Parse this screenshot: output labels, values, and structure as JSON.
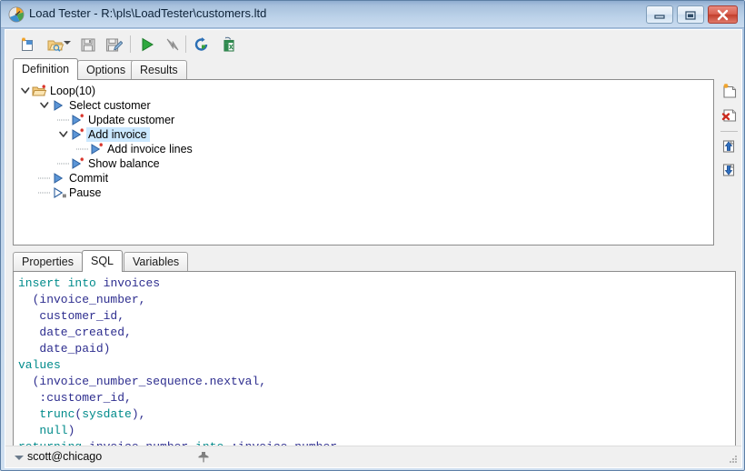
{
  "window": {
    "title": "Load Tester - R:\\pls\\LoadTester\\customers.ltd",
    "icon": "gauge-icon",
    "controls": {
      "minimize": "Minimize",
      "maximize": "Maximize",
      "close": "Close"
    },
    "colors": {
      "titlebar_top": "#8fadd0",
      "titlebar_bottom": "#c9dbef",
      "client_background": "#f0f0f0",
      "selection": "#cbe8ff",
      "close_button": "#c23f2c",
      "sql_keyword": "#008b8b",
      "sql_identifier": "#2e2e8f"
    }
  },
  "toolbar": {
    "buttons": [
      {
        "name": "new-file-button",
        "icon": "new-document-icon",
        "label": "New",
        "enabled": true,
        "has_dropdown": false
      },
      {
        "name": "open-file-button",
        "icon": "open-folder-icon",
        "label": "Open",
        "enabled": true,
        "has_dropdown": true
      },
      {
        "name": "save-button",
        "icon": "floppy-disk-icon",
        "label": "Save",
        "enabled": false,
        "has_dropdown": false
      },
      {
        "name": "save-as-button",
        "icon": "floppy-disk-pencil-icon",
        "label": "Save As",
        "enabled": false,
        "has_dropdown": false
      },
      {
        "name": "run-button",
        "icon": "green-play-icon",
        "label": "Run",
        "enabled": true,
        "has_dropdown": false
      },
      {
        "name": "break-button",
        "icon": "break-arrow-icon",
        "label": "Break",
        "enabled": false,
        "has_dropdown": false
      },
      {
        "name": "refresh-button",
        "icon": "blue-refresh-icon",
        "label": "Refresh",
        "enabled": true,
        "has_dropdown": false
      },
      {
        "name": "export-excel-button",
        "icon": "excel-export-icon",
        "label": "Export to Excel",
        "enabled": true,
        "has_dropdown": false
      }
    ]
  },
  "main_tabs": {
    "active": "Definition",
    "items": [
      {
        "label": "Definition",
        "name": "tab-definition"
      },
      {
        "label": "Options",
        "name": "tab-options"
      },
      {
        "label": "Results",
        "name": "tab-results"
      }
    ]
  },
  "tree": {
    "selected": "Add invoice",
    "nodes": [
      {
        "label": "Loop(10)",
        "depth": 0,
        "icon": "folder-star-icon",
        "expander": "expanded",
        "selected": false
      },
      {
        "label": "Select customer",
        "depth": 1,
        "icon": "play-step-icon",
        "expander": "expanded",
        "selected": false
      },
      {
        "label": "Update customer",
        "depth": 2,
        "icon": "play-step-star-icon",
        "expander": "none",
        "selected": false
      },
      {
        "label": "Add invoice",
        "depth": 2,
        "icon": "play-step-star-icon",
        "expander": "expanded",
        "selected": true
      },
      {
        "label": "Add invoice lines",
        "depth": 3,
        "icon": "play-step-star-icon",
        "expander": "none",
        "selected": false
      },
      {
        "label": "Show balance",
        "depth": 2,
        "icon": "play-step-star-icon",
        "expander": "none",
        "selected": false
      },
      {
        "label": "Commit",
        "depth": 1,
        "icon": "play-step-icon",
        "expander": "none",
        "selected": false
      },
      {
        "label": "Pause",
        "depth": 1,
        "icon": "pause-step-icon",
        "expander": "none",
        "selected": false
      }
    ]
  },
  "side_buttons": [
    {
      "name": "add-statement-button",
      "icon": "new-page-star-icon",
      "label": "Add"
    },
    {
      "name": "delete-statement-button",
      "icon": "delete-page-x-icon",
      "label": "Delete"
    },
    {
      "name": "move-up-button",
      "icon": "arrow-up-page-icon",
      "label": "Move Up"
    },
    {
      "name": "move-down-button",
      "icon": "arrow-down-page-icon",
      "label": "Move Down"
    }
  ],
  "detail_tabs": {
    "active": "SQL",
    "items": [
      {
        "label": "Properties",
        "name": "tab-properties"
      },
      {
        "label": "SQL",
        "name": "tab-sql"
      },
      {
        "label": "Variables",
        "name": "tab-variables"
      }
    ]
  },
  "sql_editor": {
    "name": "sql-text-editor",
    "text": "insert into invoices\n  (invoice_number,\n   customer_id,\n   date_created,\n   date_paid)\nvalues\n  (invoice_number_sequence.nextval,\n   :customer_id,\n   trunc(sysdate),\n   null)\nreturning invoice_number into :invoice_number",
    "lines": [
      {
        "tokens": [
          {
            "t": "insert",
            "c": "k"
          },
          {
            "t": " ",
            "c": "pl"
          },
          {
            "t": "into",
            "c": "k"
          },
          {
            "t": " ",
            "c": "pl"
          },
          {
            "t": "invoices",
            "c": "id"
          }
        ]
      },
      {
        "tokens": [
          {
            "t": "  (invoice_number,",
            "c": "id"
          }
        ]
      },
      {
        "tokens": [
          {
            "t": "   customer_id,",
            "c": "id"
          }
        ]
      },
      {
        "tokens": [
          {
            "t": "   date_created,",
            "c": "id"
          }
        ]
      },
      {
        "tokens": [
          {
            "t": "   date_paid)",
            "c": "id"
          }
        ]
      },
      {
        "tokens": [
          {
            "t": "values",
            "c": "k"
          }
        ]
      },
      {
        "tokens": [
          {
            "t": "  (invoice_number_sequence.nextval,",
            "c": "id"
          }
        ]
      },
      {
        "tokens": [
          {
            "t": "   :customer_id,",
            "c": "id"
          }
        ]
      },
      {
        "tokens": [
          {
            "t": "   ",
            "c": "pl"
          },
          {
            "t": "trunc",
            "c": "k"
          },
          {
            "t": "(",
            "c": "id"
          },
          {
            "t": "sysdate",
            "c": "k"
          },
          {
            "t": "),",
            "c": "id"
          }
        ]
      },
      {
        "tokens": [
          {
            "t": "   ",
            "c": "pl"
          },
          {
            "t": "null",
            "c": "k"
          },
          {
            "t": ")",
            "c": "id"
          }
        ]
      },
      {
        "tokens": [
          {
            "t": "returning",
            "c": "k"
          },
          {
            "t": " invoice_number ",
            "c": "id"
          },
          {
            "t": "into",
            "c": "k"
          },
          {
            "t": " :invoice_number",
            "c": "id"
          }
        ]
      }
    ]
  },
  "status_bar": {
    "connection": "scott@chicago",
    "dropdown_icon": "chevron-down-icon",
    "pin_icon": "pin-icon",
    "grip_icon": "resize-grip-icon"
  }
}
